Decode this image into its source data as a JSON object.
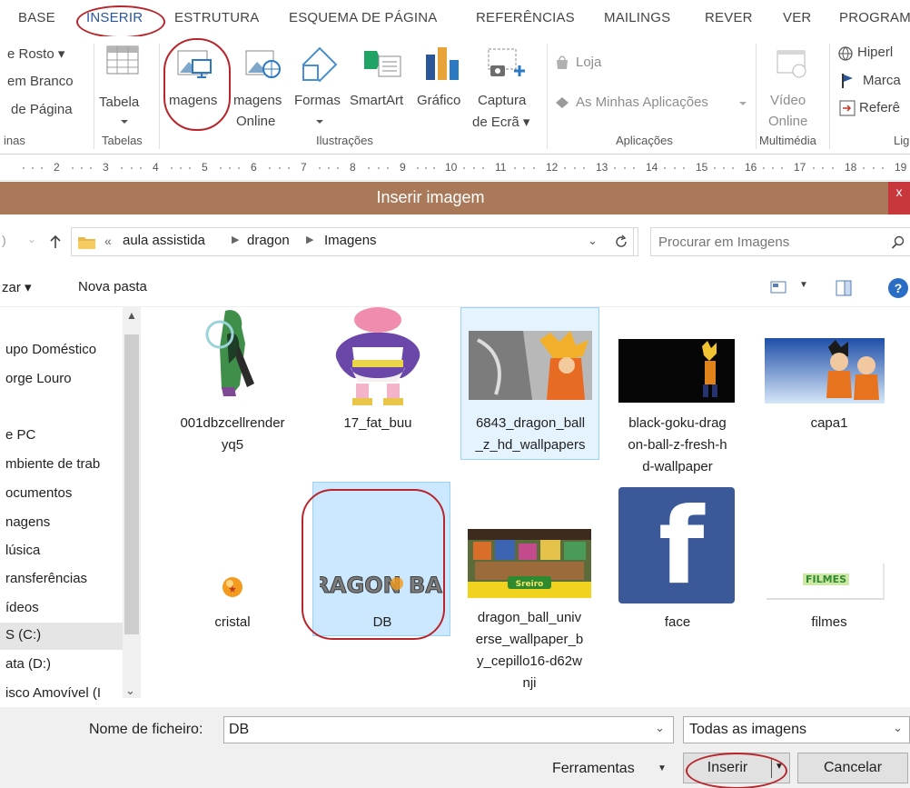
{
  "ribbon_tabs": [
    {
      "label": "BASE"
    },
    {
      "label": "INSERIR",
      "active": true
    },
    {
      "label": "ESTRUTURA"
    },
    {
      "label": "ESQUEMA DE PÁGINA"
    },
    {
      "label": "REFERÊNCIAS"
    },
    {
      "label": "MAILINGS"
    },
    {
      "label": "REVER"
    },
    {
      "label": "VER"
    },
    {
      "label": "PROGRAM"
    }
  ],
  "ribbon": {
    "pages": {
      "rosto": "e Rosto ▾",
      "branco": "em Branco",
      "quebra": "de Página",
      "group": "inas"
    },
    "tabelas": {
      "button": "Tabela",
      "group": "Tabelas"
    },
    "ilustracoes": {
      "imagens": "magens",
      "online_1": "magens",
      "online_2": "Online",
      "formas": "Formas",
      "smartart": "SmartArt",
      "grafico": "Gráfico",
      "captura_1": "Captura",
      "captura_2": "de Ecrã ▾",
      "group": "Ilustrações"
    },
    "aplicacoes": {
      "loja": "Loja",
      "minhas": "As Minhas Aplicações",
      "group": "Aplicações"
    },
    "multimedia": {
      "video_1": "Vídeo",
      "video_2": "Online",
      "group": "Multimédia"
    },
    "ligacoes": {
      "hiperligacao": "Hiperl",
      "marcador": "Marca",
      "referencia": "Referê",
      "group": "Lig"
    }
  },
  "ruler": [
    "2",
    "3",
    "4",
    "5",
    "6",
    "7",
    "8",
    "9",
    "10",
    "11",
    "12",
    "13",
    "14",
    "15",
    "16",
    "17",
    "18",
    "19"
  ],
  "dialog": {
    "title": "Inserir imagem",
    "close_glyph": "x",
    "breadcrumb": [
      "«",
      "aula assistida",
      "dragon",
      "Imagens"
    ],
    "search_placeholder": "Procurar em Imagens",
    "organize": "zar ▾",
    "new_folder": "Nova pasta",
    "nav_items": [
      "upo Doméstico",
      "orge Louro",
      "e PC",
      "mbiente de trab",
      "ocumentos",
      "nagens",
      "lúsica",
      "ransferências",
      "ídeos",
      "S (C:)",
      "ata (D:)",
      "isco Amovível (I"
    ],
    "files": [
      {
        "name_lines": [
          "001dbzcellrender",
          "yq5"
        ]
      },
      {
        "name_lines": [
          "17_fat_buu"
        ]
      },
      {
        "name_lines": [
          "6843_dragon_ball",
          "_z_hd_wallpapers"
        ]
      },
      {
        "name_lines": [
          "black-goku-drag",
          "on-ball-z-fresh-h",
          "d-wallpaper"
        ]
      },
      {
        "name_lines": [
          "capa1"
        ]
      },
      {
        "name_lines": [
          "cristal"
        ]
      },
      {
        "name_lines": [
          "DB"
        ],
        "selected": true
      },
      {
        "name_lines": [
          "dragon_ball_univ",
          "erse_wallpaper_b",
          "y_cepillo16-d62w",
          "nji"
        ]
      },
      {
        "name_lines": [
          "face"
        ]
      },
      {
        "name_lines": [
          "filmes"
        ]
      }
    ],
    "thumb_text": {
      "db_logo": "DRAGON BALL",
      "universe_banner": "Sreiro",
      "filmes_banner": "FILMES",
      "facebook": "f"
    },
    "filename_label": "Nome de ficheiro:",
    "filename_value": "DB",
    "filter_value": "Todas as imagens",
    "tools_label": "Ferramentas",
    "insert_label": "Inserir",
    "cancel_label": "Cancelar"
  },
  "colors": {
    "titlebar": "#a9795a",
    "close": "#c7373b",
    "annotation": "#b8252b",
    "selection": "#cce8ff",
    "accent": "#2b579a"
  }
}
